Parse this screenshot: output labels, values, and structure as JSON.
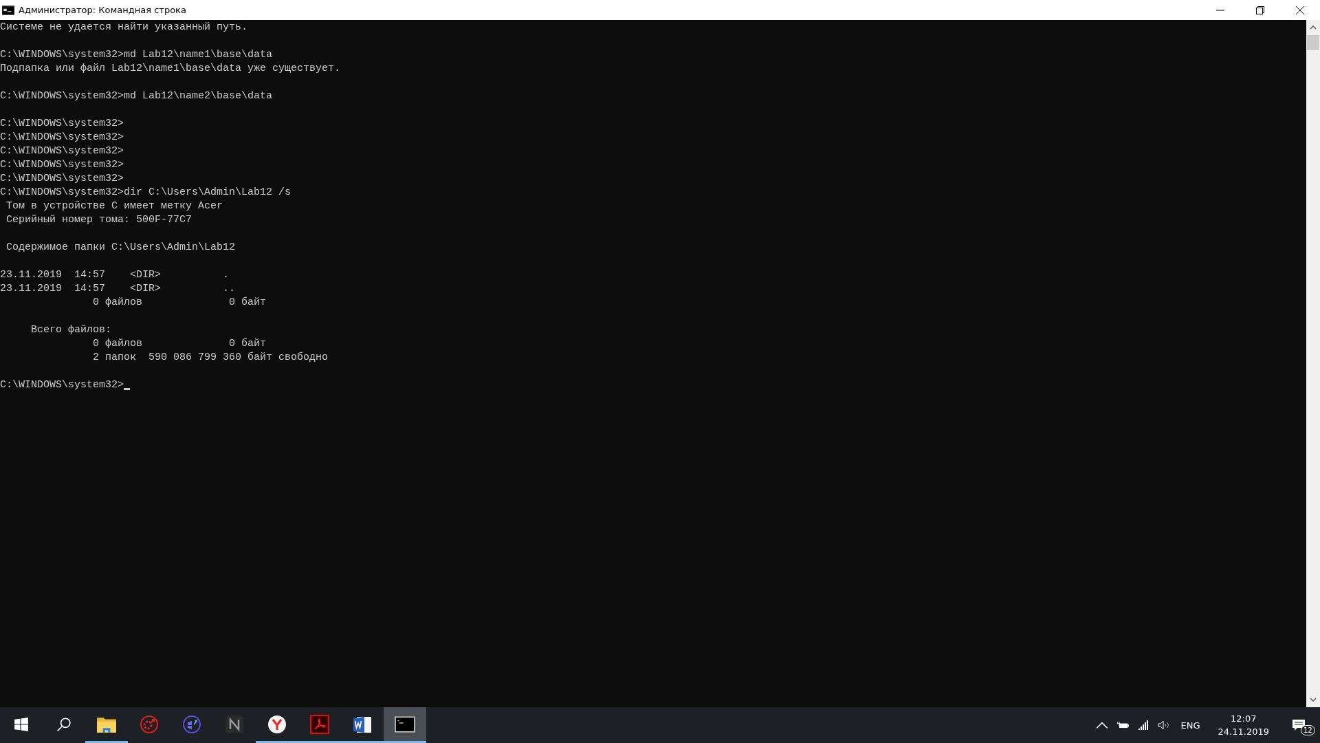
{
  "window": {
    "title": "Администратор: Командная строка"
  },
  "console": {
    "cursor": true,
    "blocks": [
      [
        "Системе не удается найти указанный путь."
      ],
      [
        "C:\\WINDOWS\\system32>md Lab12\\name1\\base\\data",
        "Подпапка или файл Lab12\\name1\\base\\data уже существует."
      ],
      [
        "C:\\WINDOWS\\system32>md Lab12\\name2\\base\\data"
      ],
      [
        "C:\\WINDOWS\\system32>",
        "C:\\WINDOWS\\system32>",
        "C:\\WINDOWS\\system32>",
        "C:\\WINDOWS\\system32>",
        "C:\\WINDOWS\\system32>",
        "C:\\WINDOWS\\system32>dir C:\\Users\\Admin\\Lab12 /s",
        " Том в устройстве C имеет метку Acer",
        " Серийный номер тома: 500F-77C7"
      ],
      [
        " Содержимое папки C:\\Users\\Admin\\Lab12"
      ],
      [
        "23.11.2019  14:57    <DIR>          .",
        "23.11.2019  14:57    <DIR>          ..",
        "               0 файлов              0 байт"
      ],
      [
        "     Всего файлов:",
        "               0 файлов              0 байт",
        "               2 папок  590 086 799 360 байт свободно"
      ],
      [
        "C:\\WINDOWS\\system32>"
      ]
    ]
  },
  "taskbar": {
    "apps": [
      {
        "kind": "start",
        "running": false,
        "selected": false
      },
      {
        "kind": "search",
        "running": false,
        "selected": false
      },
      {
        "kind": "explorer",
        "running": true,
        "selected": false
      },
      {
        "kind": "red-gear",
        "running": false,
        "selected": false
      },
      {
        "kind": "blue-shield",
        "running": false,
        "selected": false
      },
      {
        "kind": "letter-n",
        "running": false,
        "selected": false
      },
      {
        "kind": "browser-y",
        "running": true,
        "selected": false
      },
      {
        "kind": "pdf",
        "running": true,
        "selected": false
      },
      {
        "kind": "word",
        "running": true,
        "selected": false
      },
      {
        "kind": "console",
        "running": true,
        "selected": true
      }
    ],
    "tray": {
      "language": "ENG",
      "time": "12:07",
      "date": "24.11.2019",
      "notifications": "12"
    }
  }
}
